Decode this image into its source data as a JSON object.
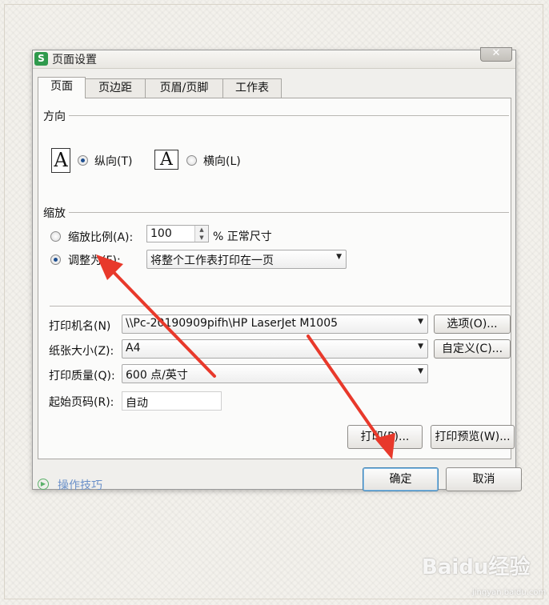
{
  "dialog": {
    "title": "页面设置",
    "app_icon": "S",
    "close_glyph": "✕"
  },
  "tabs": [
    {
      "label": "页面",
      "active": true
    },
    {
      "label": "页边距",
      "active": false
    },
    {
      "label": "页眉/页脚",
      "active": false
    },
    {
      "label": "工作表",
      "active": false
    }
  ],
  "orientation": {
    "section_label": "方向",
    "portrait_glyph": "A",
    "landscape_glyph": "A",
    "portrait_label": "纵向(T)",
    "landscape_label": "横向(L)",
    "selected": "portrait"
  },
  "scaling": {
    "section_label": "缩放",
    "scale_label": "缩放比例(A):",
    "scale_value": "100",
    "scale_unit": "% 正常尺寸",
    "fit_label": "调整为(F):",
    "fit_value": "将整个工作表打印在一页",
    "selected": "fit"
  },
  "printer": {
    "name_label": "打印机名(N)",
    "name_value": "\\\\Pc-20190909pifh\\HP LaserJet M1005",
    "options_button": "选项(O)...",
    "paper_label": "纸张大小(Z):",
    "paper_value": "A4",
    "custom_button": "自定义(C)...",
    "quality_label": "打印质量(Q):",
    "quality_value": "600 点/英寸",
    "start_page_label": "起始页码(R):",
    "start_page_value": "自动"
  },
  "buttons": {
    "print": "打印(P)...",
    "preview": "打印预览(W)...",
    "ok": "确定",
    "cancel": "取消"
  },
  "footer": {
    "tips": "操作技巧"
  },
  "watermark": {
    "text": "Baidu经验",
    "sub": "jingyan.baidu.com"
  },
  "colors": {
    "annotation_arrow": "#e8392b",
    "tips_link": "#6a90c9",
    "app_icon": "#2f9a4c"
  }
}
